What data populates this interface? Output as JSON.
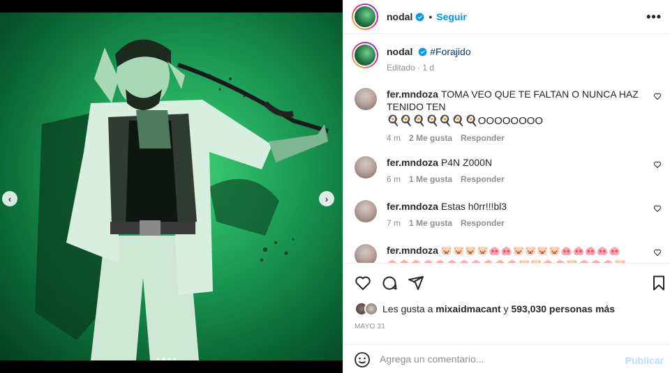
{
  "post": {
    "author": "nodal",
    "follow_label": "Seguir",
    "separator": "•",
    "more_label": "•••"
  },
  "carousel": {
    "prev_label": "‹",
    "next_label": "›",
    "slide_count": 4,
    "active_slide": 2
  },
  "caption": {
    "user": "nodal",
    "text": "#Forajido",
    "edited": "Editado",
    "dot": "·",
    "time": "1 d"
  },
  "comments": [
    {
      "user": "fer.mndoza",
      "text": "TOMA VEO QUE TE FALTAN O NUNCA HAZ TENIDO TEN",
      "text2": "🍳🍳🍳🍳🍳🍳🍳OOOOOOOO",
      "time": "4 m",
      "likes": "2 Me gusta",
      "reply": "Responder"
    },
    {
      "user": "fer.mndoza",
      "text": "P4N Z000N",
      "time": "6 m",
      "likes": "1 Me gusta",
      "reply": "Responder"
    },
    {
      "user": "fer.mndoza",
      "text": "Estas h0rr!!!bl3",
      "time": "7 m",
      "likes": "1 Me gusta",
      "reply": "Responder"
    },
    {
      "user": "fer.mndoza",
      "text": "🐷🐷🐷🐷🐽🐽🐷🐷🐷🐷🐽🐽🐽🐽🐽",
      "text2": "🐽🐽🐽🐽🐽🐽🐽🐽🐽🐽🐽🐷🐷🐽🐽🐷🐽🐽🐽🐷"
    }
  ],
  "likes": {
    "prefix": "Les gusta a ",
    "user": "mixaidmacant",
    "middle": " y ",
    "count": "593,030 personas más"
  },
  "date": "MAYO 31",
  "add_comment": {
    "placeholder": "Agrega un comentario...",
    "publish_label": "Publicar"
  },
  "colors": {
    "accent": "#0095f6",
    "publish_disabled": "#b2dffc",
    "muted": "#8e8e8e",
    "photo_green": "#1fa35a"
  }
}
